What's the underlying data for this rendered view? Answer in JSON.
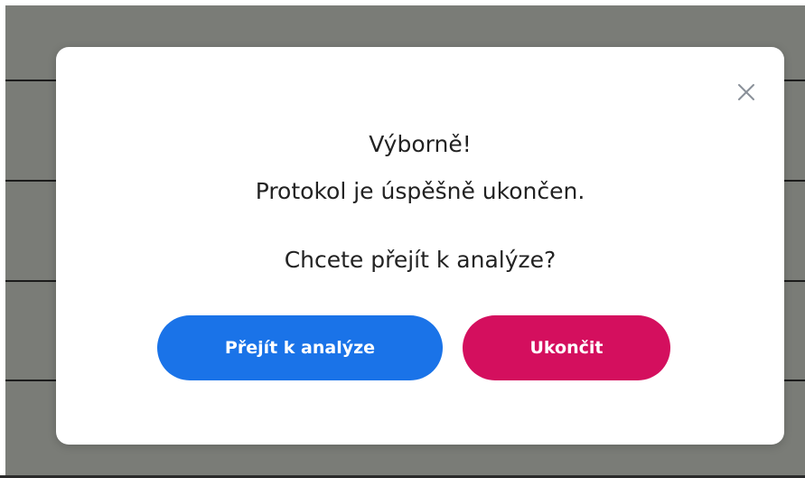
{
  "dialog": {
    "line1": "Výborně!",
    "line2": "Protokol je úspěšně ukončen.",
    "question": "Chcete přejít k analýze?",
    "primary_label": "Přejít k analýze",
    "secondary_label": "Ukončit",
    "close_icon": "close-icon"
  },
  "colors": {
    "backdrop": "#7a7c77",
    "primary": "#1a73e8",
    "secondary": "#d40f5e",
    "text": "#222222"
  }
}
